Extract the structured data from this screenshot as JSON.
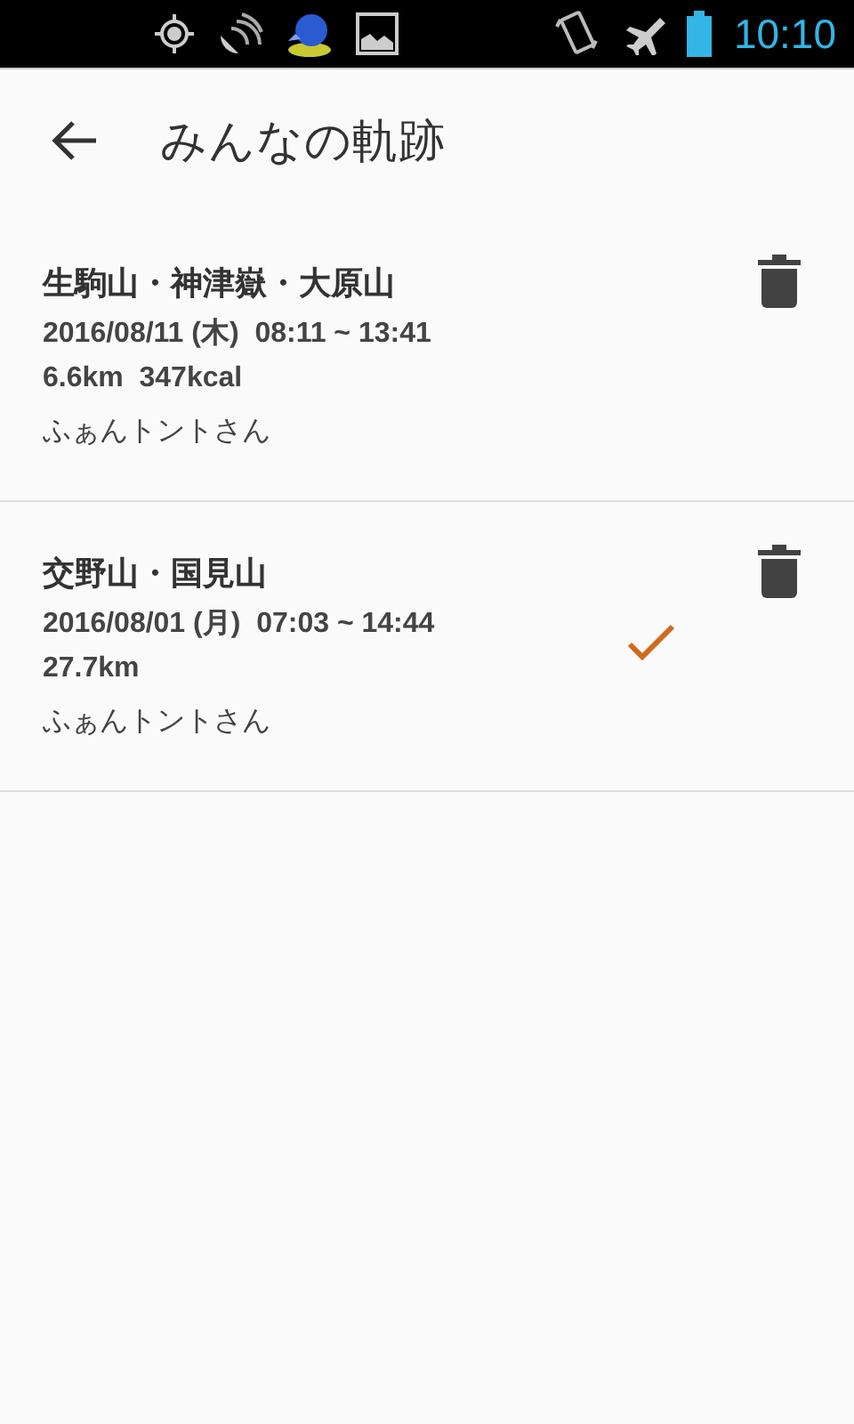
{
  "status_bar": {
    "time": "10:10"
  },
  "app_bar": {
    "title": "みんなの軌跡"
  },
  "tracks": [
    {
      "title": "生駒山・神津嶽・大原山",
      "datetime": "2016/08/11 (木)  08:11 ~ 13:41",
      "stats": "6.6km  347kcal",
      "user": "ふぁんトントさん",
      "checked": false
    },
    {
      "title": "交野山・国見山",
      "datetime": "2016/08/01 (月)  07:03 ~ 14:44",
      "stats": "27.7km",
      "user": "ふぁんトントさん",
      "checked": true
    }
  ]
}
